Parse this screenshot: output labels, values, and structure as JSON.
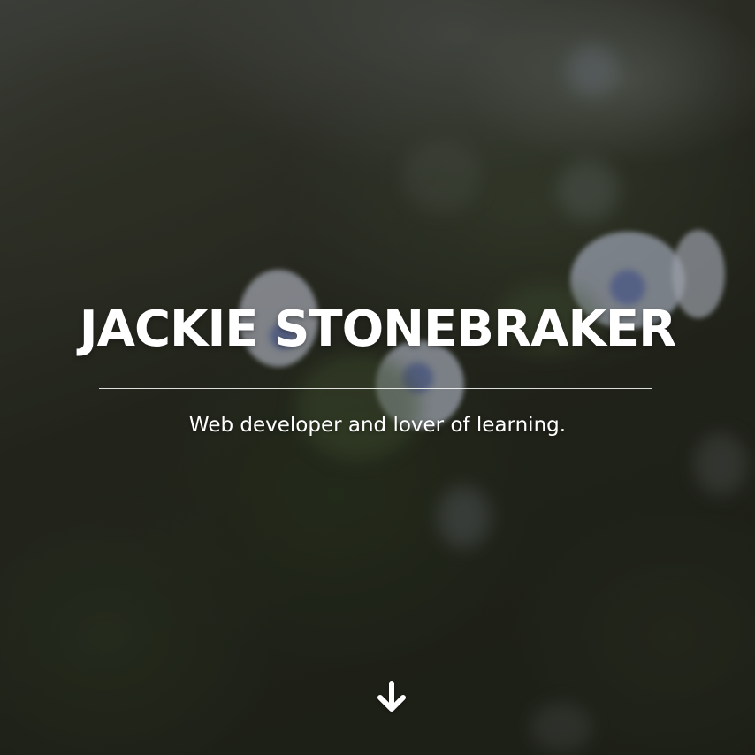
{
  "hero": {
    "title": "JACKIE STONEBRAKER",
    "subtitle": "Web developer and lover of learning."
  },
  "icons": {
    "scroll_down": "arrow-down-icon"
  },
  "colors": {
    "text": "#ffffff",
    "background": "#2a2c24"
  }
}
